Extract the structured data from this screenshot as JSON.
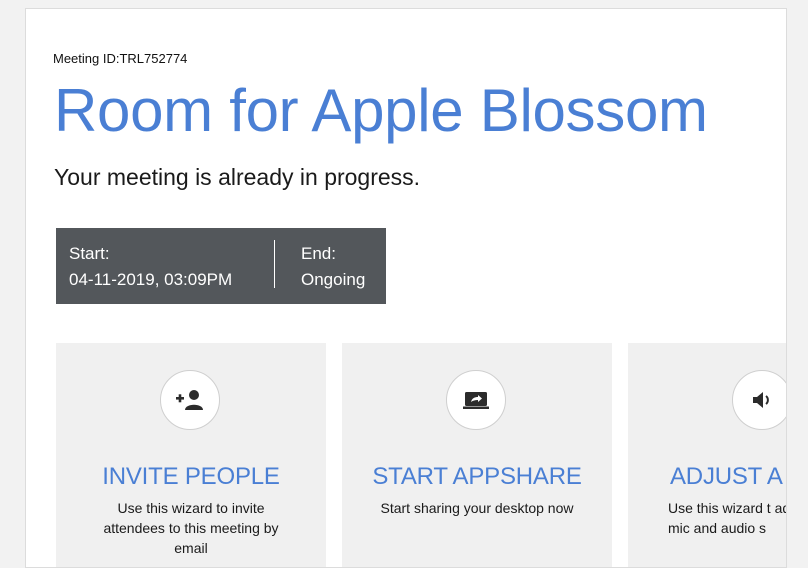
{
  "meeting": {
    "id_label": "Meeting ID:TRL752774",
    "room_title": "Room for Apple Blossom",
    "status_text": "Your meeting is already in progress.",
    "start_label": "Start:",
    "start_value": "04-11-2019, 03:09PM",
    "end_label": "End:",
    "end_value": "Ongoing"
  },
  "actions": [
    {
      "title": "INVITE PEOPLE",
      "description": "Use this wizard to invite attendees to this meeting by email",
      "icon": "add-person-icon"
    },
    {
      "title": "START APPSHARE",
      "description": "Start sharing your desktop now",
      "icon": "screen-share-icon"
    },
    {
      "title": "ADJUST A",
      "description": "Use this wizard t adjust your mic and audio s",
      "icon": "speaker-icon"
    }
  ],
  "colors": {
    "accent": "#4a7fd4",
    "time_box_bg": "#53575b",
    "card_bg": "#f0f0f0"
  }
}
